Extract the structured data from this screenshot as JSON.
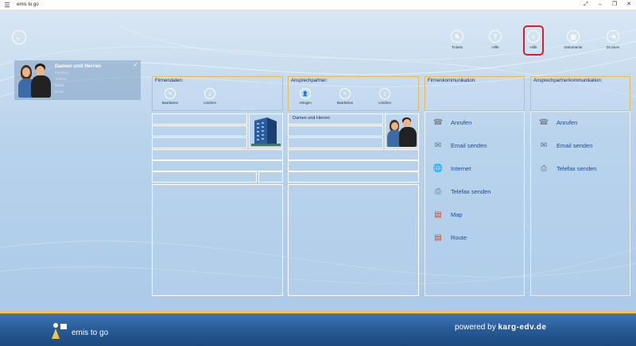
{
  "window": {
    "title": "emis to go",
    "menu_icon": "hamburger-icon"
  },
  "window_controls": [
    "⤢",
    "–",
    "❐",
    "✕"
  ],
  "toolbar": {
    "items": [
      {
        "label": "Tickets",
        "icon": "ticket-icon",
        "glyph": "✎"
      },
      {
        "label": "Hilfe",
        "icon": "help-icon",
        "glyph": "?"
      },
      {
        "label": "Hilfe",
        "icon": "face-icon",
        "glyph": "☺",
        "selected": true
      },
      {
        "label": "Dokumente",
        "icon": "documents-icon",
        "glyph": "▥"
      },
      {
        "label": "Drucken",
        "icon": "print-icon",
        "glyph": "⇥"
      }
    ]
  },
  "contact": {
    "name": "Damen und Herren",
    "details": [
      "Funktion",
      "Telefon",
      "Mobil",
      "Email"
    ]
  },
  "firmendaten": {
    "title": "Firmendaten:",
    "buttons": [
      {
        "label": "Bearbeiten",
        "glyph": "✎"
      },
      {
        "label": "Löschen",
        "glyph": "▯"
      }
    ]
  },
  "ansprechpartner": {
    "title": "Ansprechpartner:",
    "buttons": [
      {
        "label": "Anlegen",
        "glyph": "👤"
      },
      {
        "label": "Bearbeiten",
        "glyph": "✎"
      },
      {
        "label": "Löschen",
        "glyph": "▯"
      }
    ],
    "name_field": "Damen und Herren"
  },
  "firmenkommunikation": {
    "title": "Firmenkommunikation:",
    "items": [
      {
        "label": "Anrufen",
        "icon": "phone-icon",
        "glyph": "☎"
      },
      {
        "label": "Email senden",
        "icon": "mail-icon",
        "glyph": "✉"
      },
      {
        "label": "Internet",
        "icon": "globe-icon",
        "glyph": "🌐"
      },
      {
        "label": "Telefax senden",
        "icon": "fax-icon",
        "glyph": "⎙"
      },
      {
        "label": "Map",
        "icon": "map-icon",
        "glyph": "▤"
      },
      {
        "label": "Route",
        "icon": "route-icon",
        "glyph": "▤"
      }
    ]
  },
  "ansprechpartnerkommunikation": {
    "title": "Ansprechpartnerkommunikation:",
    "items": [
      {
        "label": "Anrufen",
        "icon": "phone-icon",
        "glyph": "☎"
      },
      {
        "label": "Email senden",
        "icon": "mail-icon",
        "glyph": "✉"
      },
      {
        "label": "Telefax senden",
        "icon": "fax-icon",
        "glyph": "⎙"
      }
    ]
  },
  "footer": {
    "app_name": "emis to go",
    "powered_prefix": "powered by ",
    "powered_brand": "karg-edv.de"
  },
  "colors": {
    "accent_border": "#e6ba54",
    "selection": "#d0202f",
    "link": "#1d4a93"
  }
}
